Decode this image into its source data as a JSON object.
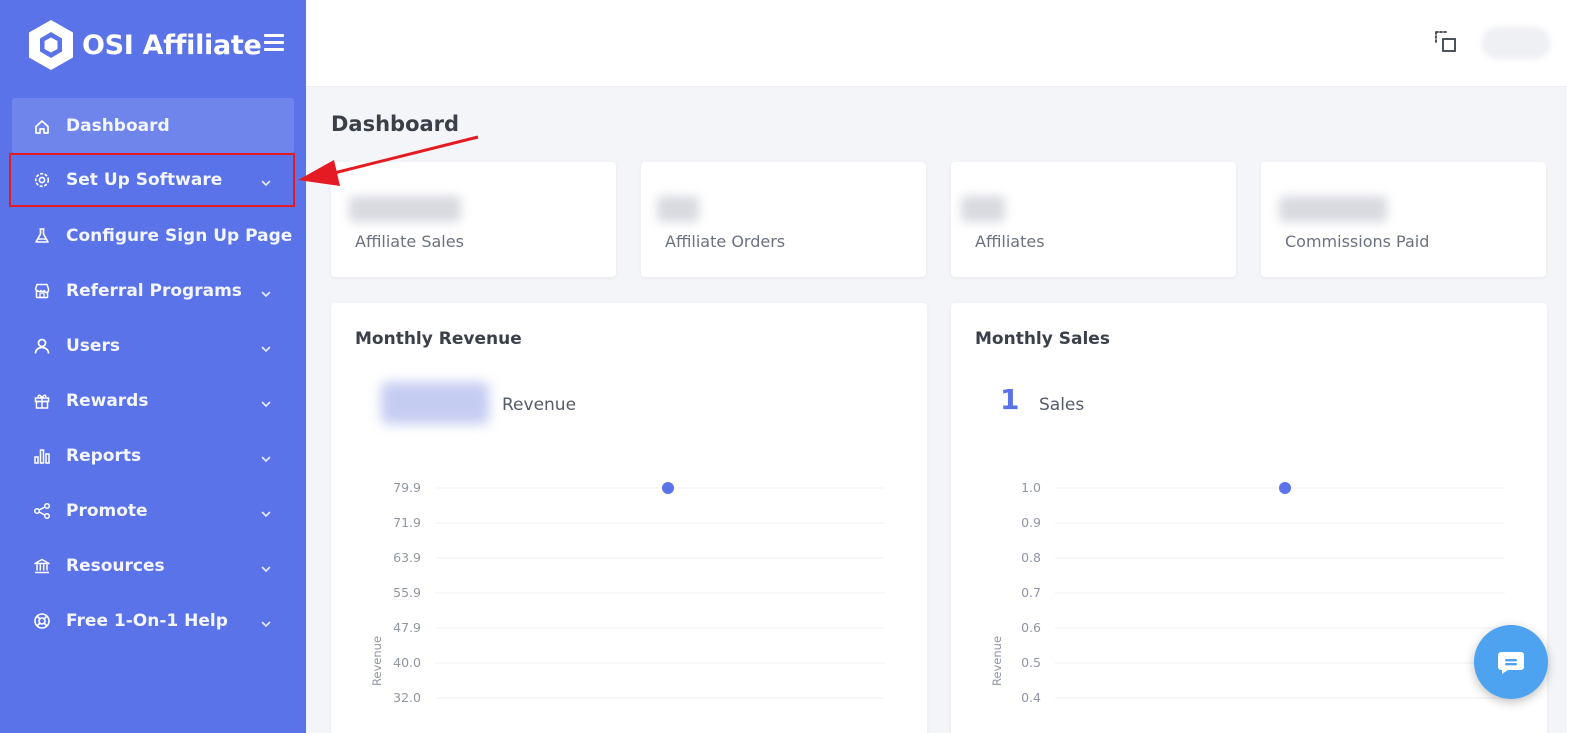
{
  "app": {
    "name": "OSI Affiliate"
  },
  "sidebar": {
    "items": [
      {
        "label": "Dashboard",
        "icon": "home-icon",
        "active": true,
        "chevron": false
      },
      {
        "label": "Set Up Software",
        "icon": "gear-icon",
        "active": false,
        "chevron": true,
        "highlighted": true
      },
      {
        "label": "Configure Sign Up Page",
        "icon": "flask-icon",
        "active": false,
        "chevron": false
      },
      {
        "label": "Referral Programs",
        "icon": "store-icon",
        "active": false,
        "chevron": true
      },
      {
        "label": "Users",
        "icon": "user-icon",
        "active": false,
        "chevron": true
      },
      {
        "label": "Rewards",
        "icon": "gift-icon",
        "active": false,
        "chevron": true
      },
      {
        "label": "Reports",
        "icon": "bar-chart-icon",
        "active": false,
        "chevron": true
      },
      {
        "label": "Promote",
        "icon": "share-icon",
        "active": false,
        "chevron": true
      },
      {
        "label": "Resources",
        "icon": "bank-icon",
        "active": false,
        "chevron": true
      },
      {
        "label": "Free 1-On-1 Help",
        "icon": "lifebuoy-icon",
        "active": false,
        "chevron": true
      }
    ]
  },
  "page": {
    "title": "Dashboard"
  },
  "stats": [
    {
      "label": "Affiliate Sales"
    },
    {
      "label": "Affiliate Orders"
    },
    {
      "label": "Affiliates"
    },
    {
      "label": "Commissions Paid"
    }
  ],
  "revenue_card": {
    "title": "Monthly Revenue",
    "kpi_label": "Revenue"
  },
  "sales_card": {
    "title": "Monthly Sales",
    "kpi_value": "1",
    "kpi_label": "Sales"
  },
  "colors": {
    "sidebar": "#5b73e8",
    "accent": "#5b73e8",
    "highlight": "#e41b23",
    "chat": "#4da3f0"
  },
  "chart_data": [
    {
      "type": "scatter",
      "title": "",
      "ylabel": "Revenue",
      "y_ticks": [
        "79.9",
        "71.9",
        "63.9",
        "55.9",
        "47.9",
        "40.0",
        "32.0"
      ],
      "ylim": [
        32.0,
        79.9
      ],
      "series": [
        {
          "values": [
            79.9
          ]
        }
      ],
      "grid": true
    },
    {
      "type": "scatter",
      "title": "",
      "ylabel": "Revenue",
      "y_ticks": [
        "1.0",
        "0.9",
        "0.8",
        "0.7",
        "0.6",
        "0.5",
        "0.4"
      ],
      "ylim": [
        0.4,
        1.0
      ],
      "series": [
        {
          "values": [
            1.0
          ]
        }
      ],
      "grid": true
    }
  ]
}
